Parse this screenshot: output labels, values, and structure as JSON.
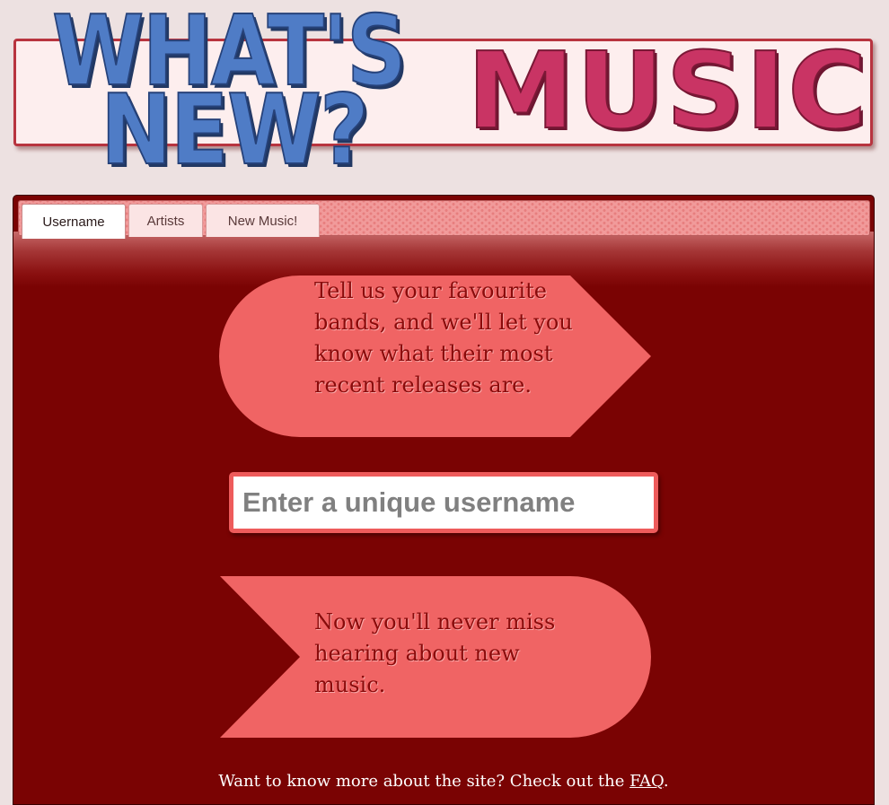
{
  "header": {
    "logo_word_1": "WHAT'S",
    "logo_word_2": "NEW?",
    "logo_word_3": "MUSIC",
    "colors": {
      "blue": "#4f7cc6",
      "pink": "#c93464"
    }
  },
  "tabs": [
    {
      "label": "Username",
      "active": true
    },
    {
      "label": "Artists",
      "active": false
    },
    {
      "label": "New Music!",
      "active": false
    }
  ],
  "intro_bubble": {
    "text": "Tell us your favourite bands, and we'll let you know what their most recent releases are."
  },
  "username_input": {
    "placeholder": "Enter a unique username",
    "value": ""
  },
  "outro_bubble": {
    "text": "Now you'll never miss hearing about new music."
  },
  "footer": {
    "prefix": "Want to know more about the site? Check out the ",
    "faq_link": "FAQ",
    "suffix": "."
  },
  "colors": {
    "panel_bg": "#7a0303",
    "bubble": "#f06464",
    "input_border": "#ee5b5b",
    "page_bg": "#ede1e1"
  }
}
